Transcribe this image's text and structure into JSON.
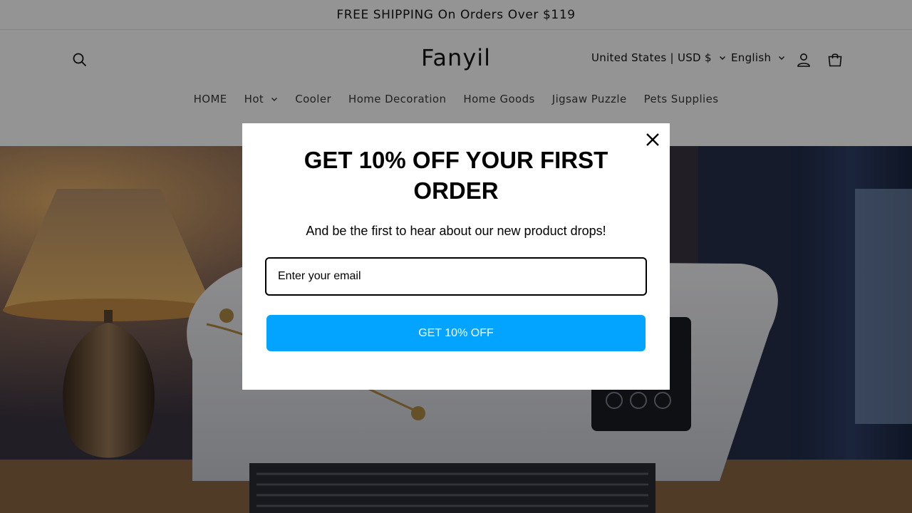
{
  "announcement": {
    "text": "FREE SHIPPING On Orders Over $119"
  },
  "header": {
    "logo": "Fanyil",
    "country_selector": "United States | USD $",
    "language_selector": "English",
    "search_icon": "search-icon",
    "account_icon": "account-icon",
    "cart_icon": "cart-icon"
  },
  "nav": {
    "items": [
      {
        "label": "HOME",
        "has_dropdown": false
      },
      {
        "label": "Hot",
        "has_dropdown": true
      },
      {
        "label": "Cooler",
        "has_dropdown": false
      },
      {
        "label": "Home Decoration",
        "has_dropdown": false
      },
      {
        "label": "Home Goods",
        "has_dropdown": false
      },
      {
        "label": "Jigsaw Puzzle",
        "has_dropdown": false
      },
      {
        "label": "Pets Supplies",
        "has_dropdown": false
      }
    ]
  },
  "popup": {
    "title": "GET 10% OFF YOUR FIRST ORDER",
    "subtitle": "And be the first to hear about our new product drops!",
    "email_placeholder": "Enter your email",
    "button_label": "GET 10% OFF",
    "button_color": "#02a4ff",
    "close_icon": "close-icon"
  }
}
